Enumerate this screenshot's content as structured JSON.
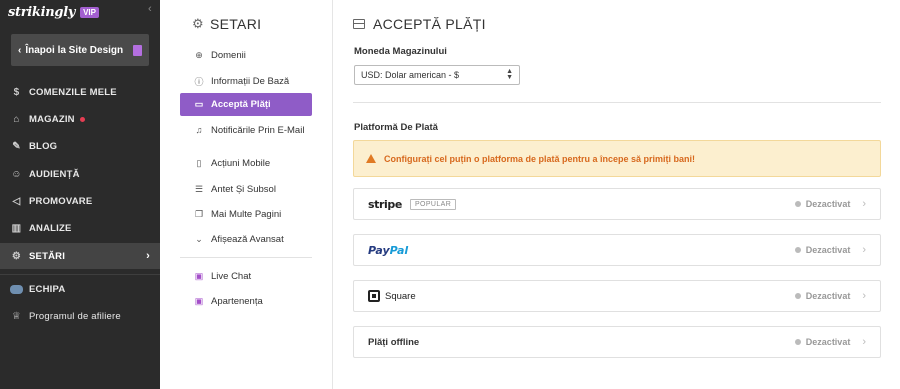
{
  "brand": {
    "logo": "strikingly",
    "badge": "VIP"
  },
  "back_button": {
    "label": "Înapoi la Site Design"
  },
  "main_nav": [
    {
      "label": "COMENZILE MELE",
      "icon": "dollar-circle-icon"
    },
    {
      "label": "MAGAZIN",
      "icon": "store-icon"
    },
    {
      "label": "BLOG",
      "icon": "pen-icon"
    },
    {
      "label": "AUDIENȚĂ",
      "icon": "users-icon"
    },
    {
      "label": "PROMOVARE",
      "icon": "megaphone-icon"
    },
    {
      "label": "ANALIZE",
      "icon": "chart-icon"
    },
    {
      "label": "SETĂRI",
      "icon": "gear-icon"
    },
    {
      "label": "ECHIPA",
      "icon": "team-icon"
    },
    {
      "label": "Programul de afiliere",
      "icon": "trophy-icon"
    }
  ],
  "settings": {
    "title": "SETARI",
    "items": [
      {
        "label": "Domenii"
      },
      {
        "label": "Informații De Bază"
      },
      {
        "label": "Acceptă Plăți"
      },
      {
        "label": "Notificările Prin E-Mail"
      },
      {
        "label": "Acțiuni Mobile"
      },
      {
        "label": "Antet Și Subsol"
      },
      {
        "label": "Mai Multe Pagini"
      },
      {
        "label": "Afișează Avansat"
      },
      {
        "label": "Live Chat"
      },
      {
        "label": "Apartenența"
      }
    ]
  },
  "main": {
    "title": "ACCEPTĂ PLĂȚI",
    "currency_label": "Moneda Magazinului",
    "currency_value": "USD: Dolar american - $",
    "platform_label": "Platformă De Plată",
    "warning": "Configurați cel puțin o platforma de plată pentru a începe să primiți bani!",
    "providers": [
      {
        "name": "stripe",
        "badge": "POPULAR",
        "status": "Dezactivat"
      },
      {
        "name_part1": "Pay",
        "name_part2": "Pal",
        "status": "Dezactivat"
      },
      {
        "name": "Square",
        "status": "Dezactivat"
      },
      {
        "name": "Plăți offline",
        "status": "Dezactivat"
      }
    ]
  },
  "colors": {
    "sidebar_bg": "#2b2b2b",
    "accent_purple": "#8f5cc7",
    "warning_bg": "#fcefcf",
    "warning_text": "#d7691e",
    "notification_dot": "#e53d52"
  }
}
